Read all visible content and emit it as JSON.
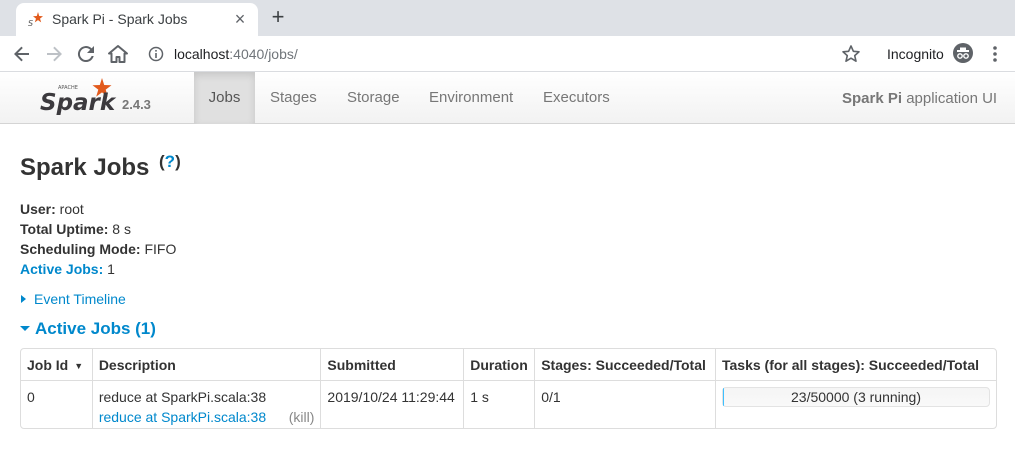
{
  "browser": {
    "tab_title": "Spark Pi - Spark Jobs",
    "url_host": "localhost",
    "url_path": ":4040/jobs/",
    "profile_label": "Incognito"
  },
  "navbar": {
    "version": "2.4.3",
    "items": [
      {
        "label": "Jobs",
        "active": true
      },
      {
        "label": "Stages",
        "active": false
      },
      {
        "label": "Storage",
        "active": false
      },
      {
        "label": "Environment",
        "active": false
      },
      {
        "label": "Executors",
        "active": false
      }
    ],
    "app_name": "Spark Pi",
    "app_suffix": " application UI"
  },
  "page": {
    "title": "Spark Jobs",
    "help": "?",
    "summary": {
      "user_label": "User:",
      "user_value": " root",
      "uptime_label": "Total Uptime:",
      "uptime_value": " 8 s",
      "mode_label": "Scheduling Mode:",
      "mode_value": " FIFO",
      "active_label": "Active Jobs:",
      "active_value": " 1"
    },
    "event_timeline": "Event Timeline",
    "active_section": "Active Jobs (1)"
  },
  "table": {
    "headers": [
      "Job Id",
      "Description",
      "Submitted",
      "Duration",
      "Stages: Succeeded/Total",
      "Tasks (for all stages): Succeeded/Total"
    ],
    "sort_indicator": "▼",
    "rows": [
      {
        "job_id": "0",
        "description": "reduce at SparkPi.scala:38",
        "description_link": "reduce at SparkPi.scala:38",
        "kill": "(kill)",
        "submitted": "2019/10/24 11:29:44",
        "duration": "1 s",
        "stages": "0/1",
        "tasks": "23/50000 (3 running)",
        "tasks_progress": 0.00046
      }
    ]
  },
  "colors": {
    "link": "#0088cc",
    "spark_orange": "#e25a1c",
    "progress_fill": "#3ec0ff"
  }
}
